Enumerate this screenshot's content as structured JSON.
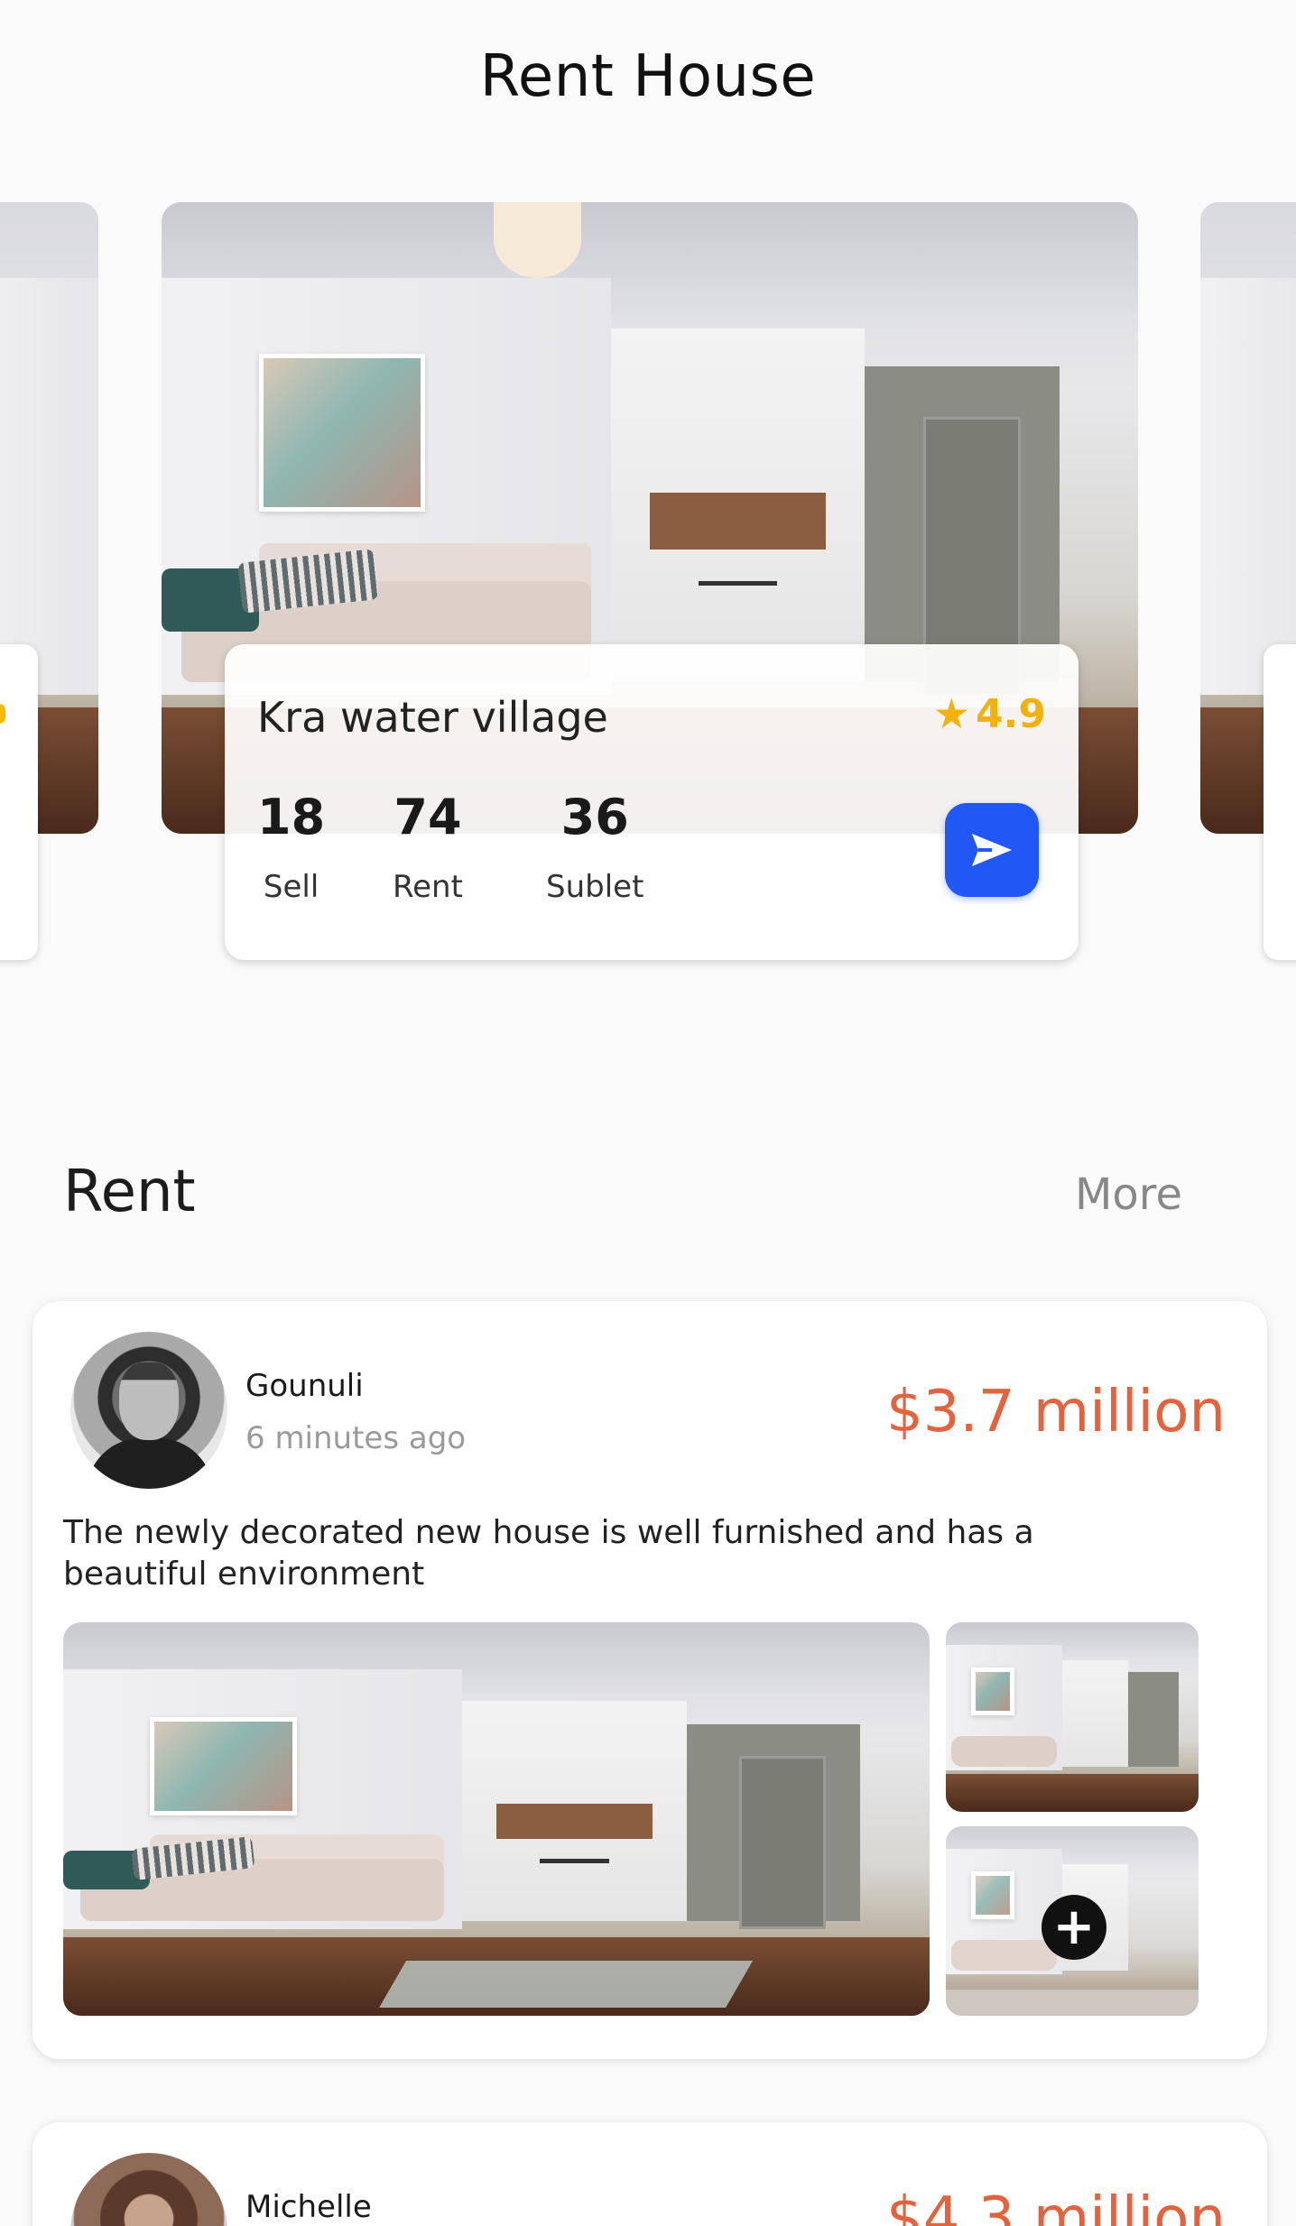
{
  "page": {
    "title": "Rent House"
  },
  "featured": {
    "name": "Kra water village",
    "rating": "4.9",
    "stats": [
      {
        "value": "18",
        "label": "Sell"
      },
      {
        "value": "74",
        "label": "Rent"
      },
      {
        "value": "36",
        "label": "Sublet"
      }
    ],
    "send_icon": "send-icon",
    "star_icon": "star-icon",
    "accent_color": "#2158f5",
    "rating_color": "#f2b10c"
  },
  "section": {
    "title": "Rent",
    "more_label": "More"
  },
  "listings": [
    {
      "user": "Gounuli",
      "time": "6 minutes ago",
      "price": "$3.7 million",
      "description": "The newly decorated new house is well furnished and has a beautiful environment",
      "more_photos_icon": "plus-icon",
      "price_color": "#e4633f"
    },
    {
      "user": "Michelle",
      "price": "$4.3 million"
    }
  ]
}
